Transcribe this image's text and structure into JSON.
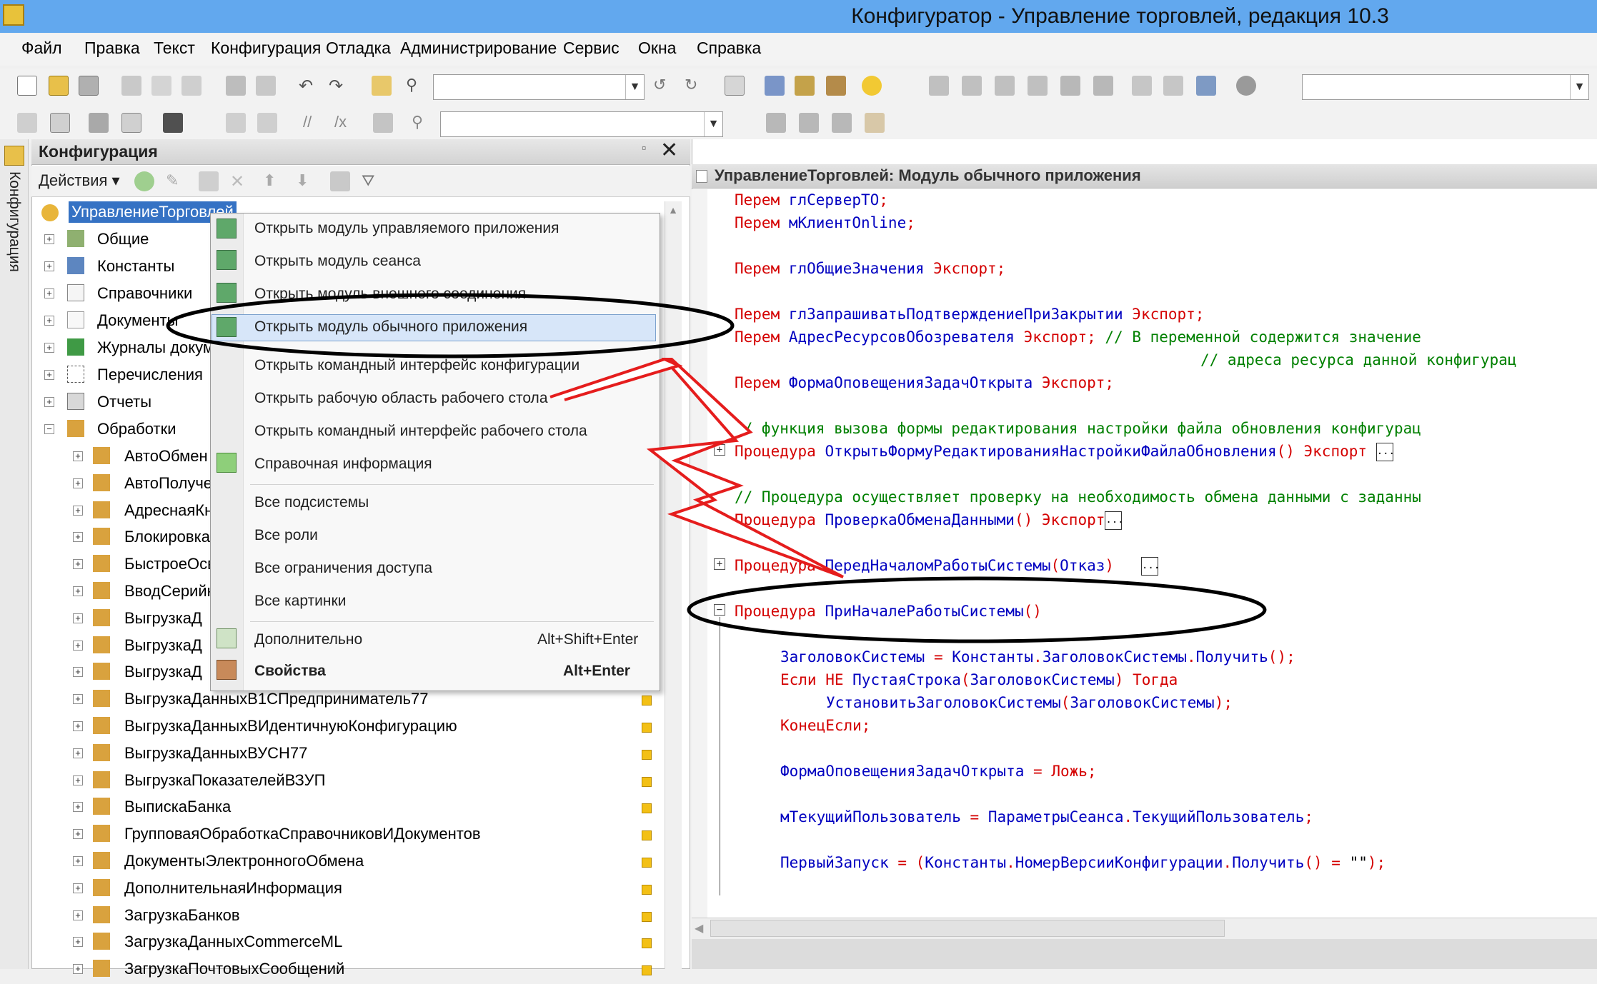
{
  "window": {
    "title": "Конфигуратор - Управление торговлей, редакция 10.3"
  },
  "menu": [
    "Файл",
    "Правка",
    "Текст",
    "Конфигурация",
    "Отладка",
    "Администрирование",
    "Сервис",
    "Окна",
    "Справка"
  ],
  "side_tab": "Конфигурация",
  "config_panel": {
    "title": "Конфигурация",
    "actions_label": "Действия",
    "tree": {
      "root": "УправлениеТорговлей",
      "top_items": [
        "Общие",
        "Константы",
        "Справочники",
        "Документы",
        "Журналы документов",
        "Перечисления",
        "Отчеты",
        "Обработки"
      ],
      "processings": [
        "АвтоОбмен",
        "АвтоПолучение",
        "АдреснаяКнига",
        "Блокировка",
        "БыстроеОсвоение",
        "ВводСерийных",
        "ВыгрузкаД",
        "ВыгрузкаД",
        "ВыгрузкаД",
        "ВыгрузкаДанныхВ1СПредприниматель77",
        "ВыгрузкаДанныхВИдентичнуюКонфигурацию",
        "ВыгрузкаДанныхВУСН77",
        "ВыгрузкаПоказателейВЗУП",
        "ВыпискаБанка",
        "ГрупповаяОбработкаСправочниковИДокументов",
        "ДокументыЭлектронногоОбмена",
        "ДополнительнаяИнформация",
        "ЗагрузкаБанков",
        "ЗагрузкаДанныхCommerceML",
        "ЗагрузкаПочтовыхСообщений"
      ]
    }
  },
  "context_menu": {
    "items": [
      {
        "label": "Открыть модуль управляемого приложения"
      },
      {
        "label": "Открыть модуль сеанса"
      },
      {
        "label": "Открыть модуль внешнего соединения"
      },
      {
        "label": "Открыть модуль обычного приложения"
      },
      {
        "label": "Открыть командный интерфейс конфигурации"
      },
      {
        "label": "Открыть рабочую область рабочего стола"
      },
      {
        "label": "Открыть командный интерфейс рабочего стола"
      },
      {
        "label": "Справочная информация"
      },
      {
        "label": "Все подсистемы"
      },
      {
        "label": "Все роли"
      },
      {
        "label": "Все ограничения доступа"
      },
      {
        "label": "Все картинки"
      },
      {
        "label": "Дополнительно",
        "shortcut": "Alt+Shift+Enter"
      },
      {
        "label": "Свойства",
        "shortcut": "Alt+Enter"
      }
    ],
    "highlighted": "Открыть модуль обычного приложения"
  },
  "editor": {
    "title": "УправлениеТорговлей: Модуль обычного приложения",
    "lines": {
      "l1a": "Перем ",
      "l1b": "глСерверТО",
      "l1c": ";",
      "l2a": "Перем ",
      "l2b": "мКлиентOnline",
      "l2c": ";",
      "l3a": "Перем ",
      "l3b": "глОбщиеЗначения ",
      "l3c": "Экспорт;",
      "l4a": "Перем ",
      "l4b": "глЗапрашиватьПодтверждениеПриЗакрытии ",
      "l4c": "Экспорт;",
      "l5a": "Перем ",
      "l5b": "АдресРесурсовОбозревателя ",
      "l5c": "Экспорт; ",
      "l5d": "// В переменной содержится значение",
      "l6d": "// адреса ресурса данной конфигурац",
      "l7a": "Перем ",
      "l7b": "ФормаОповещенияЗадачОткрыта ",
      "l7c": "Экспорт;",
      "l8": "// функция вызова формы редактирования настройки файла обновления конфигурац",
      "l9a": "Процедура ",
      "l9b": "ОткрытьФормуРедактированияНастройкиФайлаОбновления",
      "l9c": "() Экспорт",
      "l10": "// Процедура осуществляет проверку на необходимость обмена данными с заданны",
      "l11a": "Процедура ",
      "l11b": "ПроверкаОбменаДанными",
      "l11c": "() Экспорт",
      "l12a": "Процедура ",
      "l12b": "ПередНачаломРаботыСистемы",
      "l12c": "(",
      "l12d": "Отказ",
      "l12e": ")",
      "l13a": "Процедура ",
      "l13b": "ПриНачалеРаботыСистемы",
      "l13c": "()",
      "l14a": "ЗаголовокСистемы",
      "l14b": " = ",
      "l14c": "Константы",
      "l14d": ".",
      "l14e": "ЗаголовокСистемы",
      "l14f": ".",
      "l14g": "Получить",
      "l14h": "();",
      "l15a": "Если НЕ ",
      "l15b": "ПустаяСтрока",
      "l15c": "(",
      "l15d": "ЗаголовокСистемы",
      "l15e": ") Тогда",
      "l16a": "УстановитьЗаголовокСистемы",
      "l16b": "(",
      "l16c": "ЗаголовокСистемы",
      "l16d": ");",
      "l17": "КонецЕсли;",
      "l18a": "ФормаОповещенияЗадачОткрыта",
      "l18b": " = ",
      "l18c": "Ложь;",
      "l19a": "мТекущийПользователь",
      "l19b": " = ",
      "l19c": "ПараметрыСеанса",
      "l19d": ".",
      "l19e": "ТекущийПользователь",
      "l19f": ";",
      "l20a": "ПервыйЗапуск",
      "l20b": " = (",
      "l20c": "Константы",
      "l20d": ".",
      "l20e": "НомерВерсииКонфигурации",
      "l20f": ".",
      "l20g": "Получить",
      "l20h": "() = ",
      "l20i": "\"\"",
      "l20j": ");"
    },
    "fold_dots": "..."
  },
  "colors": {
    "titlebar": "#62a8ee",
    "keyword": "#d40000",
    "identifier": "#0000c0",
    "comment": "#008000",
    "highlight": "#d7e6f9"
  }
}
